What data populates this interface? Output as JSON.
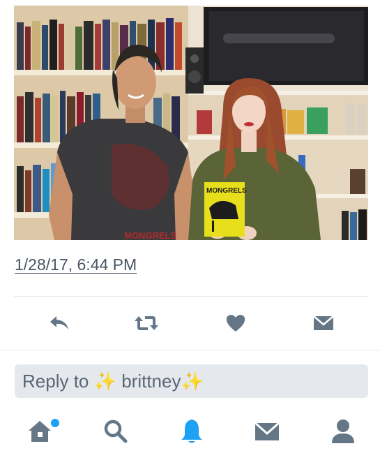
{
  "tweet": {
    "timestamp": "1/28/17, 6:44 PM",
    "book_title": "MONGRELS",
    "shirt_text": "MONGRELS"
  },
  "actions": [
    {
      "name": "reply-icon"
    },
    {
      "name": "retweet-icon"
    },
    {
      "name": "like-icon"
    },
    {
      "name": "direct-message-icon"
    }
  ],
  "composer": {
    "reply_label": "Reply to ✨ brittney✨"
  },
  "tabbar": {
    "items": [
      "home-icon",
      "search-icon",
      "notifications-icon",
      "messages-icon",
      "profile-icon"
    ],
    "active": "notifications",
    "home_has_new": true
  },
  "colors": {
    "icon_gray": "#657786",
    "twitter_blue": "#1da1f2",
    "reply_bg": "#e5e9ee",
    "divider": "#e1e8ed"
  }
}
